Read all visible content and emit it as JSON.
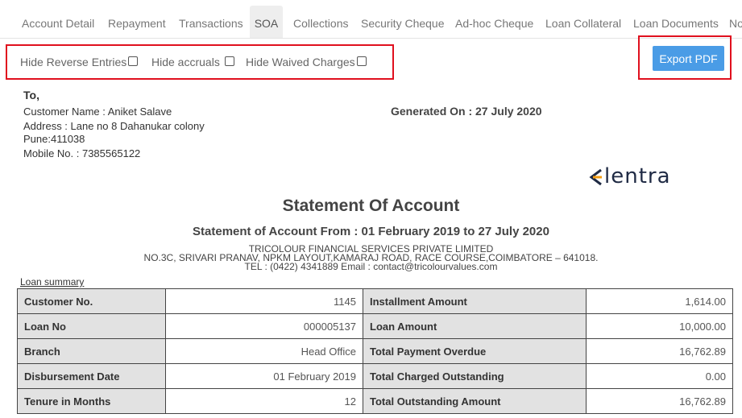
{
  "tabs": [
    {
      "label": "Account Detail"
    },
    {
      "label": "Repayment"
    },
    {
      "label": "Transactions"
    },
    {
      "label": "SOA"
    },
    {
      "label": "Collections"
    },
    {
      "label": "Security Cheque"
    },
    {
      "label": "Ad-hoc Cheque"
    },
    {
      "label": "Loan Collateral"
    },
    {
      "label": "Loan Documents"
    },
    {
      "label": "No"
    }
  ],
  "active_tab": "SOA",
  "filters": {
    "hide_reverse": "Hide Reverse Entries",
    "hide_accruals": "Hide accruals",
    "hide_waived": "Hide Waived Charges"
  },
  "export_label": "Export PDF",
  "address": {
    "to": "To,",
    "customer_name": "Customer Name : Aniket Salave",
    "address": "Address : Lane no 8 Dahanukar colony",
    "pune": "Pune:411038",
    "mobile": "Mobile No. : 7385565122"
  },
  "generated_on": "Generated On : 27 July 2020",
  "logo_text": "lentra",
  "statement": {
    "title": "Statement Of Account",
    "subtitle": "Statement of Account From : 01 February 2019 to 27 July 2020",
    "company": "TRICOLOUR FINANCIAL SERVICES PRIVATE LIMITED",
    "company_address": "NO.3C, SRIVARI PRANAV, NPKM LAYOUT,KAMARAJ ROAD, RACE COURSE,COIMBATORE – 641018.",
    "company_contact": "TEL : (0422) 4341889 Email : contact@tricolourvalues.com"
  },
  "summary_title": "Loan summary",
  "summary_rows": [
    {
      "l1": "Customer No.",
      "v1": "1145",
      "l2": "Installment Amount",
      "v2": "1,614.00"
    },
    {
      "l1": "Loan No",
      "v1": "000005137",
      "l2": "Loan Amount",
      "v2": "10,000.00"
    },
    {
      "l1": "Branch",
      "v1": "Head Office",
      "l2": "Total Payment Overdue",
      "v2": "16,762.89"
    },
    {
      "l1": "Disbursement Date",
      "v1": "01 February 2019",
      "l2": "Total Charged Outstanding",
      "v2": "0.00"
    },
    {
      "l1": "Tenure in Months",
      "v1": "12",
      "l2": "Total Outstanding Amount",
      "v2": "16,762.89"
    }
  ],
  "colors": {
    "accent": "#4a9ce6",
    "highlight_border": "#e0101e",
    "label_bg": "#e2e2e2"
  }
}
